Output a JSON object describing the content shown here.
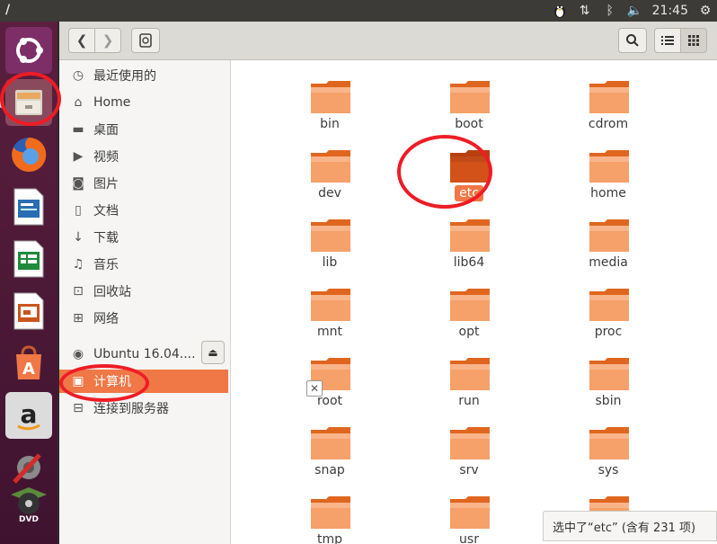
{
  "topbar": {
    "title": "/",
    "time": "21:45",
    "tray_icons": [
      "tux-icon",
      "network-arrows-icon",
      "bluetooth-icon",
      "volume-icon",
      "power-gear-icon"
    ]
  },
  "launcher": {
    "items": [
      "ubuntu-dash-icon",
      "files-icon",
      "firefox-icon",
      "writer-icon",
      "calc-icon",
      "impress-icon",
      "software-center-icon",
      "amazon-icon",
      "system-settings-icon",
      "dvd-icon"
    ]
  },
  "sidebar": {
    "items": [
      {
        "label": "最近使用的",
        "icon": "clock-icon"
      },
      {
        "label": "Home",
        "icon": "home-icon"
      },
      {
        "label": "桌面",
        "icon": "folder-icon"
      },
      {
        "label": "视频",
        "icon": "video-icon"
      },
      {
        "label": "图片",
        "icon": "camera-icon"
      },
      {
        "label": "文档",
        "icon": "document-icon"
      },
      {
        "label": "下载",
        "icon": "download-icon"
      },
      {
        "label": "音乐",
        "icon": "music-icon"
      },
      {
        "label": "回收站",
        "icon": "trash-icon"
      },
      {
        "label": "网络",
        "icon": "network-icon"
      },
      {
        "label": "Ubuntu 16.04....",
        "icon": "disc-icon"
      },
      {
        "label": "计算机",
        "icon": "computer-icon"
      },
      {
        "label": "连接到服务器",
        "icon": "server-icon"
      }
    ]
  },
  "folders": [
    "bin",
    "boot",
    "cdrom",
    "dev",
    "etc",
    "home",
    "lib",
    "lib64",
    "media",
    "mnt",
    "opt",
    "proc",
    "root",
    "run",
    "sbin",
    "snap",
    "srv",
    "sys",
    "tmp",
    "usr",
    ""
  ],
  "selected_folder": "etc",
  "status": "选中了“etc” (含有 231 项)",
  "colors": {
    "accent": "#f07746",
    "folder": "#e8743a",
    "annotation": "#ee1c25"
  }
}
